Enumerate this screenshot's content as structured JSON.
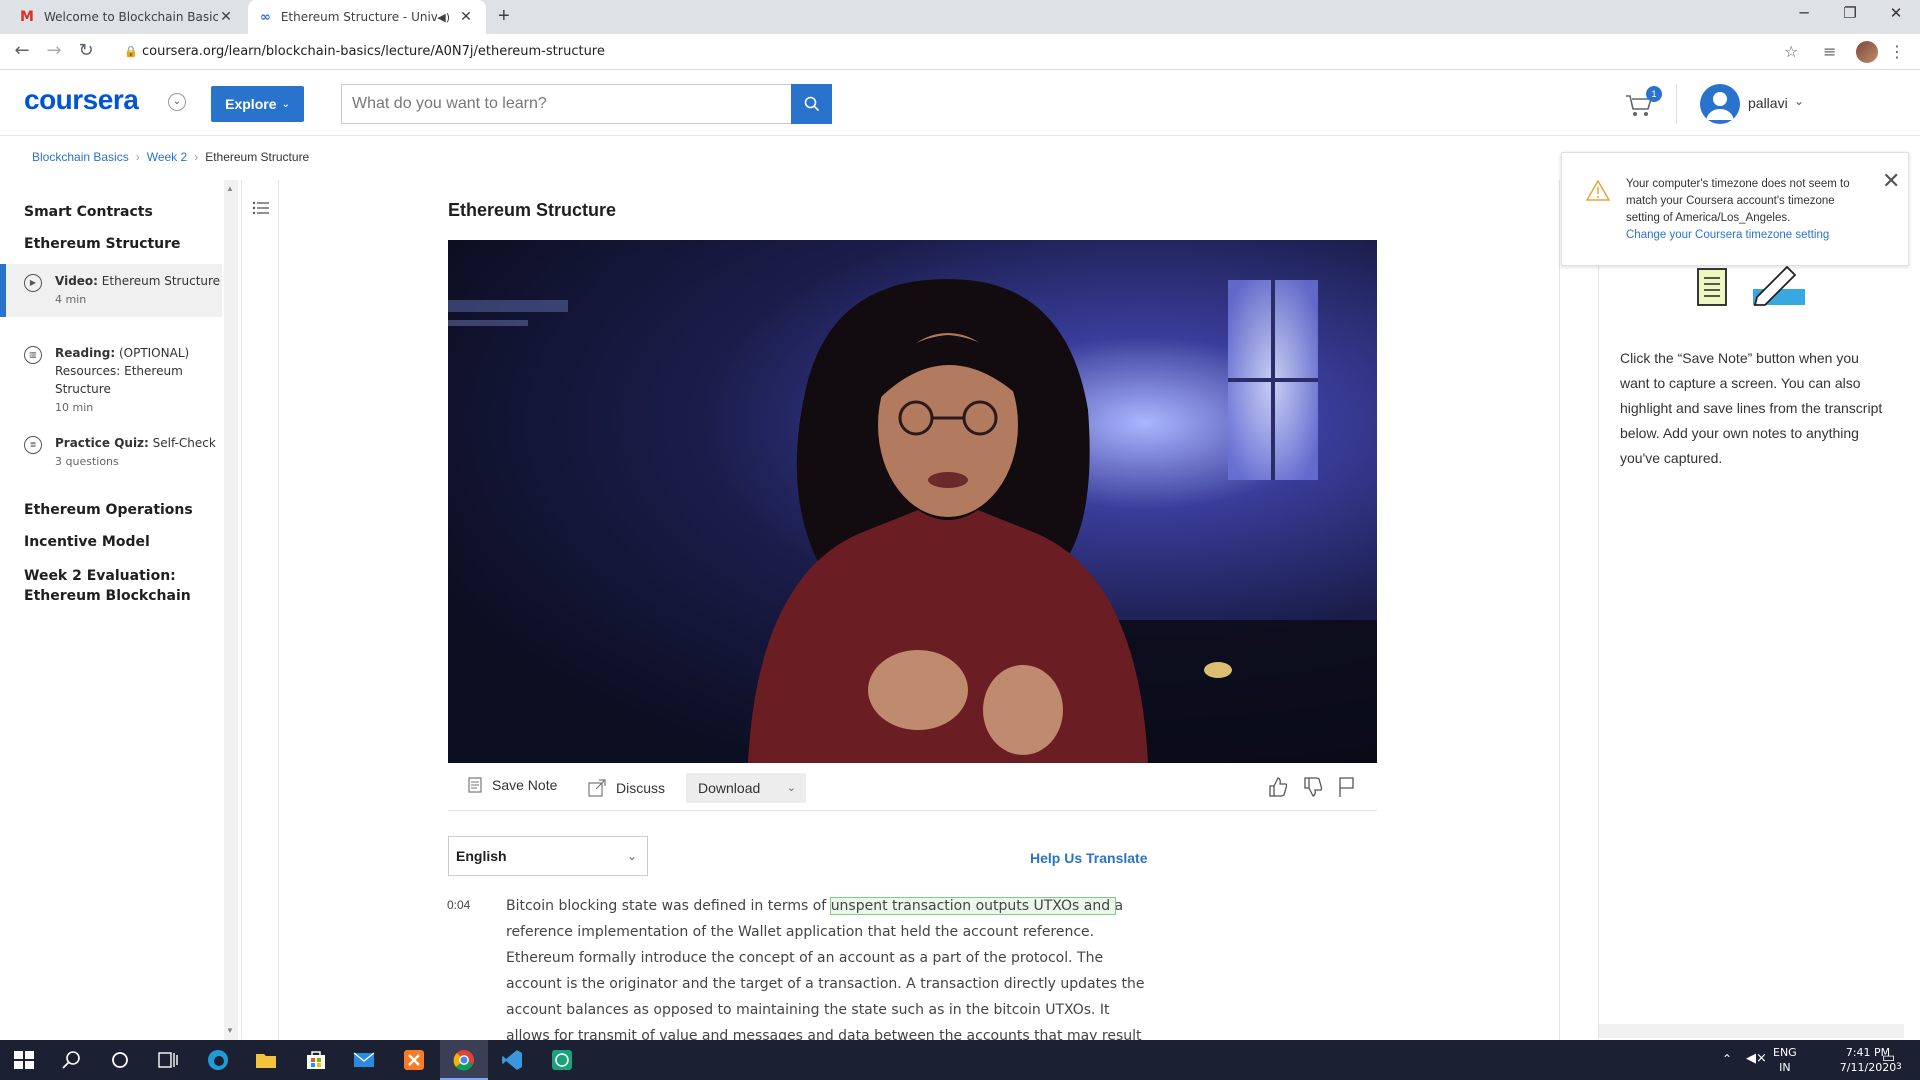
{
  "browser": {
    "tabs": [
      {
        "title": "Welcome to Blockchain Basics - B"
      },
      {
        "title": "Ethereum Structure - Univers"
      }
    ],
    "url": "coursera.org/learn/blockchain-basics/lecture/A0N7j/ethereum-structure"
  },
  "header": {
    "logo": "coursera",
    "explore_label": "Explore",
    "search_placeholder": "What do you want to learn?",
    "cart_count": "1",
    "username": "pallavi"
  },
  "breadcrumb": [
    "Blockchain Basics",
    "Week 2",
    "Ethereum Structure"
  ],
  "sidebar": {
    "sections": [
      "Smart Contracts",
      "Ethereum Structure",
      "Ethereum Operations",
      "Incentive Model",
      "Week 2 Evaluation: Ethereum Blockchain"
    ],
    "items": [
      {
        "type": "Video:",
        "title": "Ethereum Structure",
        "duration": "4 min",
        "active": true
      },
      {
        "type": "Reading:",
        "title": "(OPTIONAL) Resources: Ethereum Structure",
        "duration": "10 min"
      },
      {
        "type": "Practice Quiz:",
        "title": "Self-Check",
        "duration": "3 questions"
      }
    ]
  },
  "main": {
    "title": "Ethereum Structure",
    "toolbar": {
      "save_note": "Save Note",
      "discuss": "Discuss",
      "download": "Download"
    },
    "language": "English",
    "help_translate": "Help Us Translate",
    "transcript": {
      "timestamp": "0:04",
      "before": "Bitcoin blocking state was defined in terms of ",
      "highlight": "unspent transaction outputs UTXOs and ",
      "after": "a reference implementation of the Wallet application that held the account reference. Ethereum formally introduce the concept of an account as a part of the protocol. The account is the originator and the target of a transaction. A transaction directly updates the account balances as opposed to maintaining the state such as in the bitcoin UTXOs. It allows for transmit of value and messages and data between the accounts that may result in the state transitions. These transfers are"
    }
  },
  "notes_panel": {
    "text": "Click the “Save Note” button when you want to capture a screen. You can also highlight and save lines from the transcript below. Add your own notes to anything you've captured."
  },
  "toast": {
    "message": "Your computer's timezone does not seem to match your Coursera account's timezone setting of America/Los_Angeles.",
    "link": "Change your Coursera timezone setting"
  },
  "taskbar": {
    "lang": "ENG",
    "region": "IN",
    "time": "7:41 PM",
    "date": "7/11/2020",
    "notifications": "3"
  }
}
